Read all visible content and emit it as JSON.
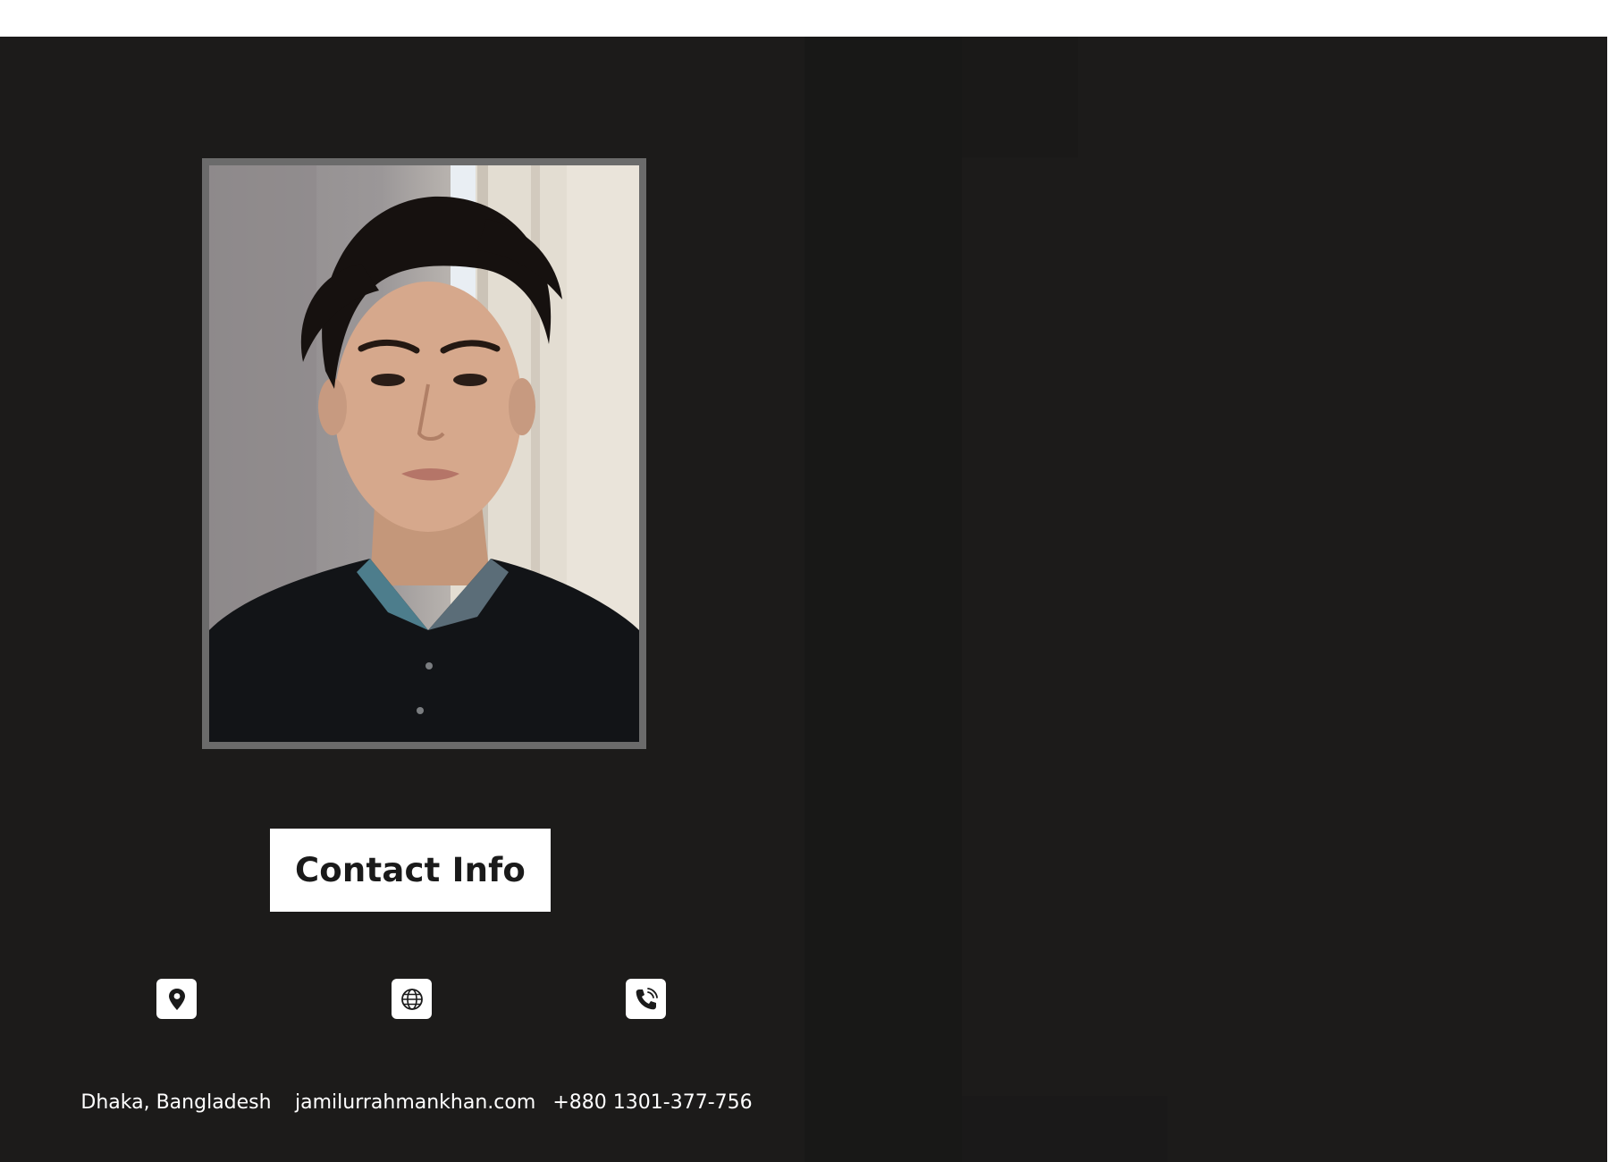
{
  "profile": {
    "photo_alt": "Profile photo"
  },
  "contact": {
    "title": "Contact Info",
    "items": [
      {
        "icon": "location-pin-icon",
        "text": "Dhaka, Bangladesh"
      },
      {
        "icon": "globe-icon",
        "text": "jamilurrahmankhan.com"
      },
      {
        "icon": "phone-icon",
        "text": "+880 1301-377-756"
      }
    ]
  },
  "colors": {
    "background": "#1c1b1a",
    "frame": "#6b6b6b",
    "label_bg": "#ffffff",
    "text": "#ffffff"
  }
}
